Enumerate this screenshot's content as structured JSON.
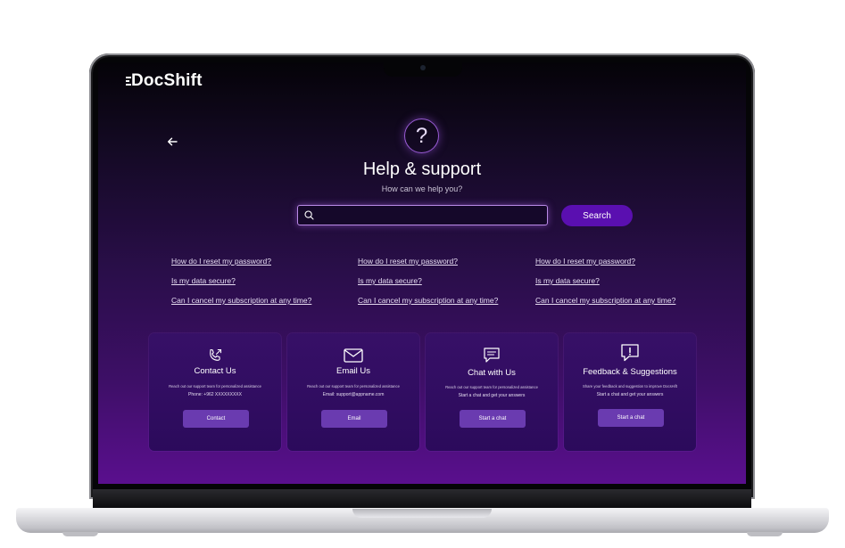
{
  "app": {
    "logo_text": "DocShift"
  },
  "header": {
    "help_icon_glyph": "?",
    "title": "Help & support",
    "subtitle": "How can we help you?"
  },
  "search": {
    "placeholder": "",
    "value": "",
    "button_label": "Search"
  },
  "faq": {
    "columns": [
      {
        "links": [
          "How do I reset my password?",
          " Is my data secure?",
          "Can I cancel my subscription at any time?"
        ]
      },
      {
        "links": [
          "How do I reset my password?",
          " Is my data secure?",
          "Can I cancel my subscription at any time?"
        ]
      },
      {
        "links": [
          "How do I reset my password?",
          " Is my data secure?",
          "Can I cancel my subscription at any time?"
        ]
      }
    ]
  },
  "cards": [
    {
      "icon": "phone-icon",
      "title": "Contact Us",
      "description": "Reach out our support team for personalized assistance",
      "detail": "Phone: +962 XXXXXXXXX",
      "button_label": "Contact"
    },
    {
      "icon": "mail-icon",
      "title": "Email Us",
      "description": "Reach out our support team for personalized assistance",
      "detail": "Email: support@appname.com",
      "button_label": "Email"
    },
    {
      "icon": "chat-icon",
      "title": "Chat with Us",
      "description": "Reach out our support team for personalized assistance",
      "detail": "Start a chat and get your answers",
      "button_label": "Start a chat"
    },
    {
      "icon": "feedback-icon",
      "title": "Feedback & Suggestions",
      "description": "Share your feedback and suggestion to improve DocsHift",
      "detail": "Start a chat and get your answers",
      "button_label": "Start a chat"
    }
  ],
  "colors": {
    "accent": "#5a0fb0",
    "card_button": "#6a3bb0",
    "search_glow": "#b98ae6"
  }
}
